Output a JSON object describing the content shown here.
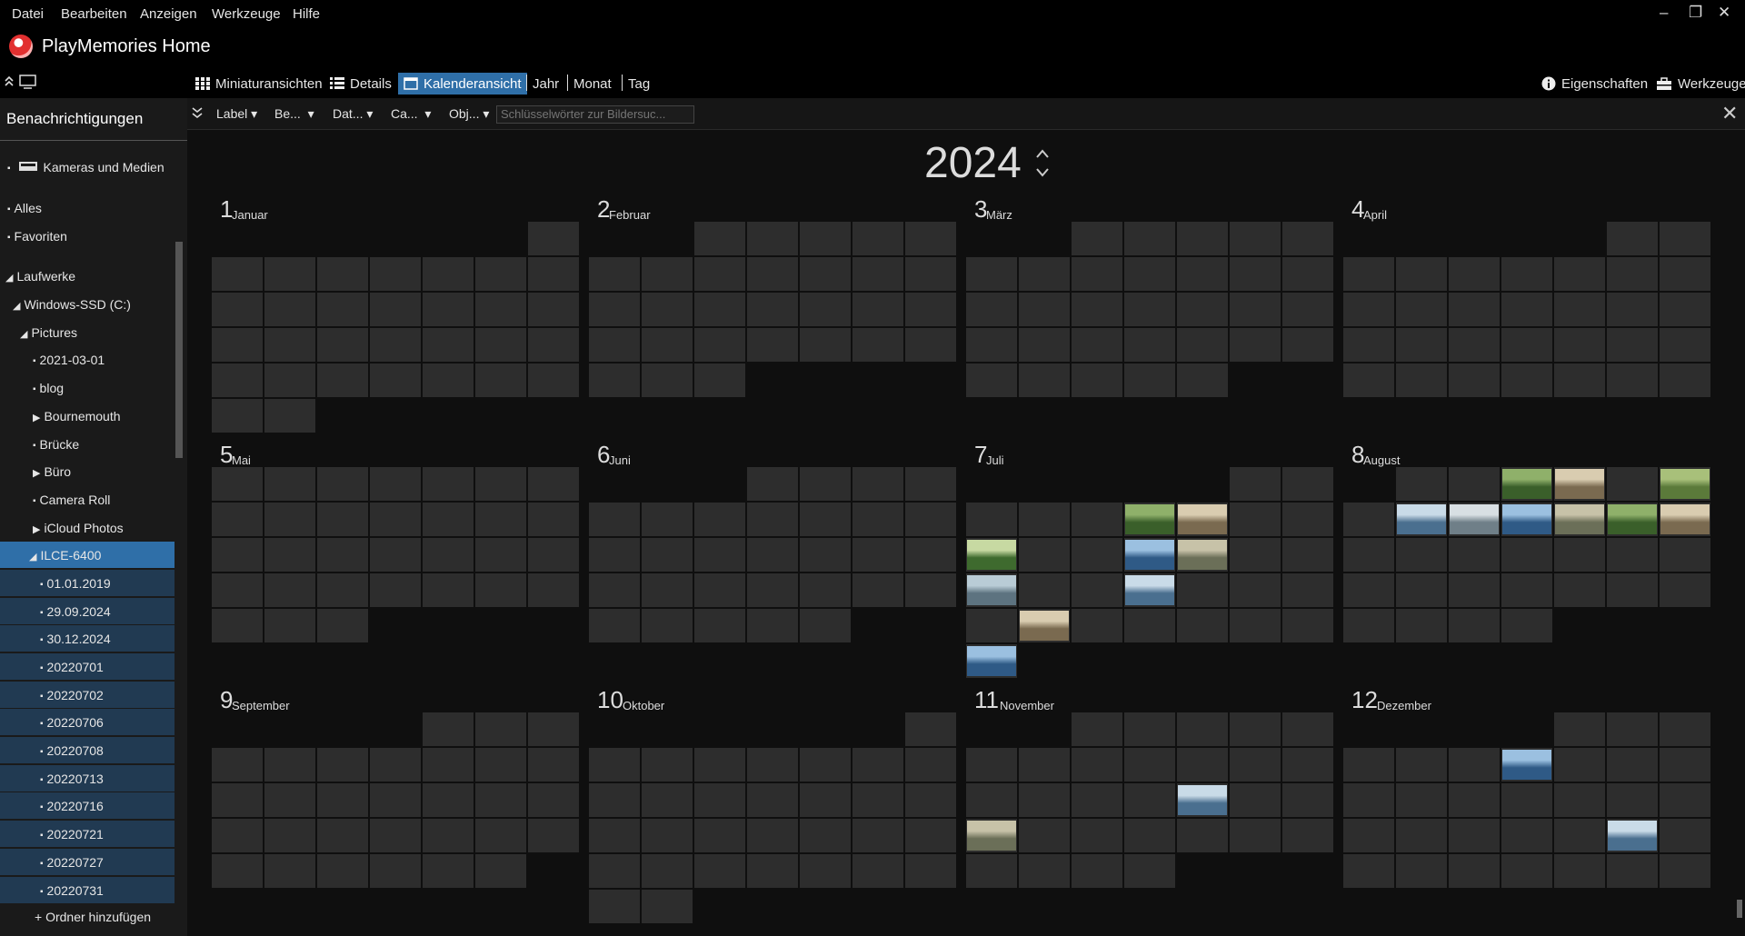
{
  "menu": [
    "Datei",
    "Bearbeiten",
    "Anzeigen",
    "Werkzeuge",
    "Hilfe"
  ],
  "window_controls": {
    "minimize": "–",
    "restore": "❐",
    "close": "✕"
  },
  "app_title": "PlayMemories Home",
  "view_tabs": {
    "thumbnails": "Miniaturansichten",
    "details": "Details",
    "calendar": "Kalenderansicht",
    "year": "Jahr",
    "month": "Monat",
    "day": "Tag"
  },
  "right_tools": {
    "properties": "Eigenschaften",
    "tools": "Werkzeuge"
  },
  "sidebar": {
    "heading": "Benachrichtigungen",
    "add_folder": "+ Ordner hinzufügen",
    "items": [
      {
        "label": "Kameras und Medien",
        "marker": "▪"
      },
      {
        "label": "Alles",
        "marker": "▪"
      },
      {
        "label": "Favoriten",
        "marker": "▪"
      },
      {
        "label": "Laufwerke",
        "marker": "◢"
      },
      {
        "label": "Windows-SSD (C:)",
        "marker": "◢"
      },
      {
        "label": "Pictures",
        "marker": "◢"
      },
      {
        "label": "2021-03-01",
        "marker": "▪"
      },
      {
        "label": "blog",
        "marker": "▪"
      },
      {
        "label": "Bournemouth",
        "marker": "▶"
      },
      {
        "label": "Brücke",
        "marker": "▪"
      },
      {
        "label": "Büro",
        "marker": "▶"
      },
      {
        "label": "Camera Roll",
        "marker": "▪"
      },
      {
        "label": "iCloud Photos",
        "marker": "▶"
      },
      {
        "label": "ILCE-6400",
        "marker": "◢"
      },
      {
        "label": "01.01.2019",
        "marker": "▪"
      },
      {
        "label": "29.09.2024",
        "marker": "▪"
      },
      {
        "label": "30.12.2024",
        "marker": "▪"
      },
      {
        "label": "20220701",
        "marker": "▪"
      },
      {
        "label": "20220702",
        "marker": "▪"
      },
      {
        "label": "20220706",
        "marker": "▪"
      },
      {
        "label": "20220708",
        "marker": "▪"
      },
      {
        "label": "20220713",
        "marker": "▪"
      },
      {
        "label": "20220716",
        "marker": "▪"
      },
      {
        "label": "20220721",
        "marker": "▪"
      },
      {
        "label": "20220727",
        "marker": "▪"
      },
      {
        "label": "20220731",
        "marker": "▪"
      }
    ]
  },
  "toolbar": {
    "filters": [
      "Label",
      "Be...",
      "Dat...",
      "Ca...",
      "Obj..."
    ],
    "search_placeholder": "Schlüsselwörter zur Bildersuc..."
  },
  "calendar": {
    "year": "2024",
    "months": [
      {
        "num": "1",
        "name": "Januar",
        "offset": 6,
        "days": 31,
        "photos": []
      },
      {
        "num": "2",
        "name": "Februar",
        "offset": 2,
        "days": 29,
        "photos": []
      },
      {
        "num": "3",
        "name": "März",
        "offset": 2,
        "days": 31,
        "photos": []
      },
      {
        "num": "4",
        "name": "April",
        "offset": 5,
        "days": 30,
        "photos": []
      },
      {
        "num": "5",
        "name": "Mai",
        "offset": 0,
        "days": 31,
        "photos": []
      },
      {
        "num": "6",
        "name": "Juni",
        "offset": 3,
        "days": 30,
        "photos": []
      },
      {
        "num": "7",
        "name": "Juli",
        "offset": 5,
        "days": 31,
        "photos": [
          6,
          7,
          10,
          13,
          14,
          17,
          20,
          25,
          31
        ]
      },
      {
        "num": "8",
        "name": "August",
        "offset": 1,
        "days": 31,
        "photos": [
          3,
          4,
          6,
          8,
          9,
          10,
          11,
          12,
          13
        ]
      },
      {
        "num": "9",
        "name": "September",
        "offset": 4,
        "days": 30,
        "photos": []
      },
      {
        "num": "10",
        "name": "Oktober",
        "offset": 6,
        "days": 31,
        "photos": []
      },
      {
        "num": "11",
        "name": "November",
        "offset": 2,
        "days": 30,
        "photos": [
          17,
          20
        ]
      },
      {
        "num": "12",
        "name": "Dezember",
        "offset": 4,
        "days": 31,
        "photos": [
          7,
          23
        ]
      }
    ]
  }
}
